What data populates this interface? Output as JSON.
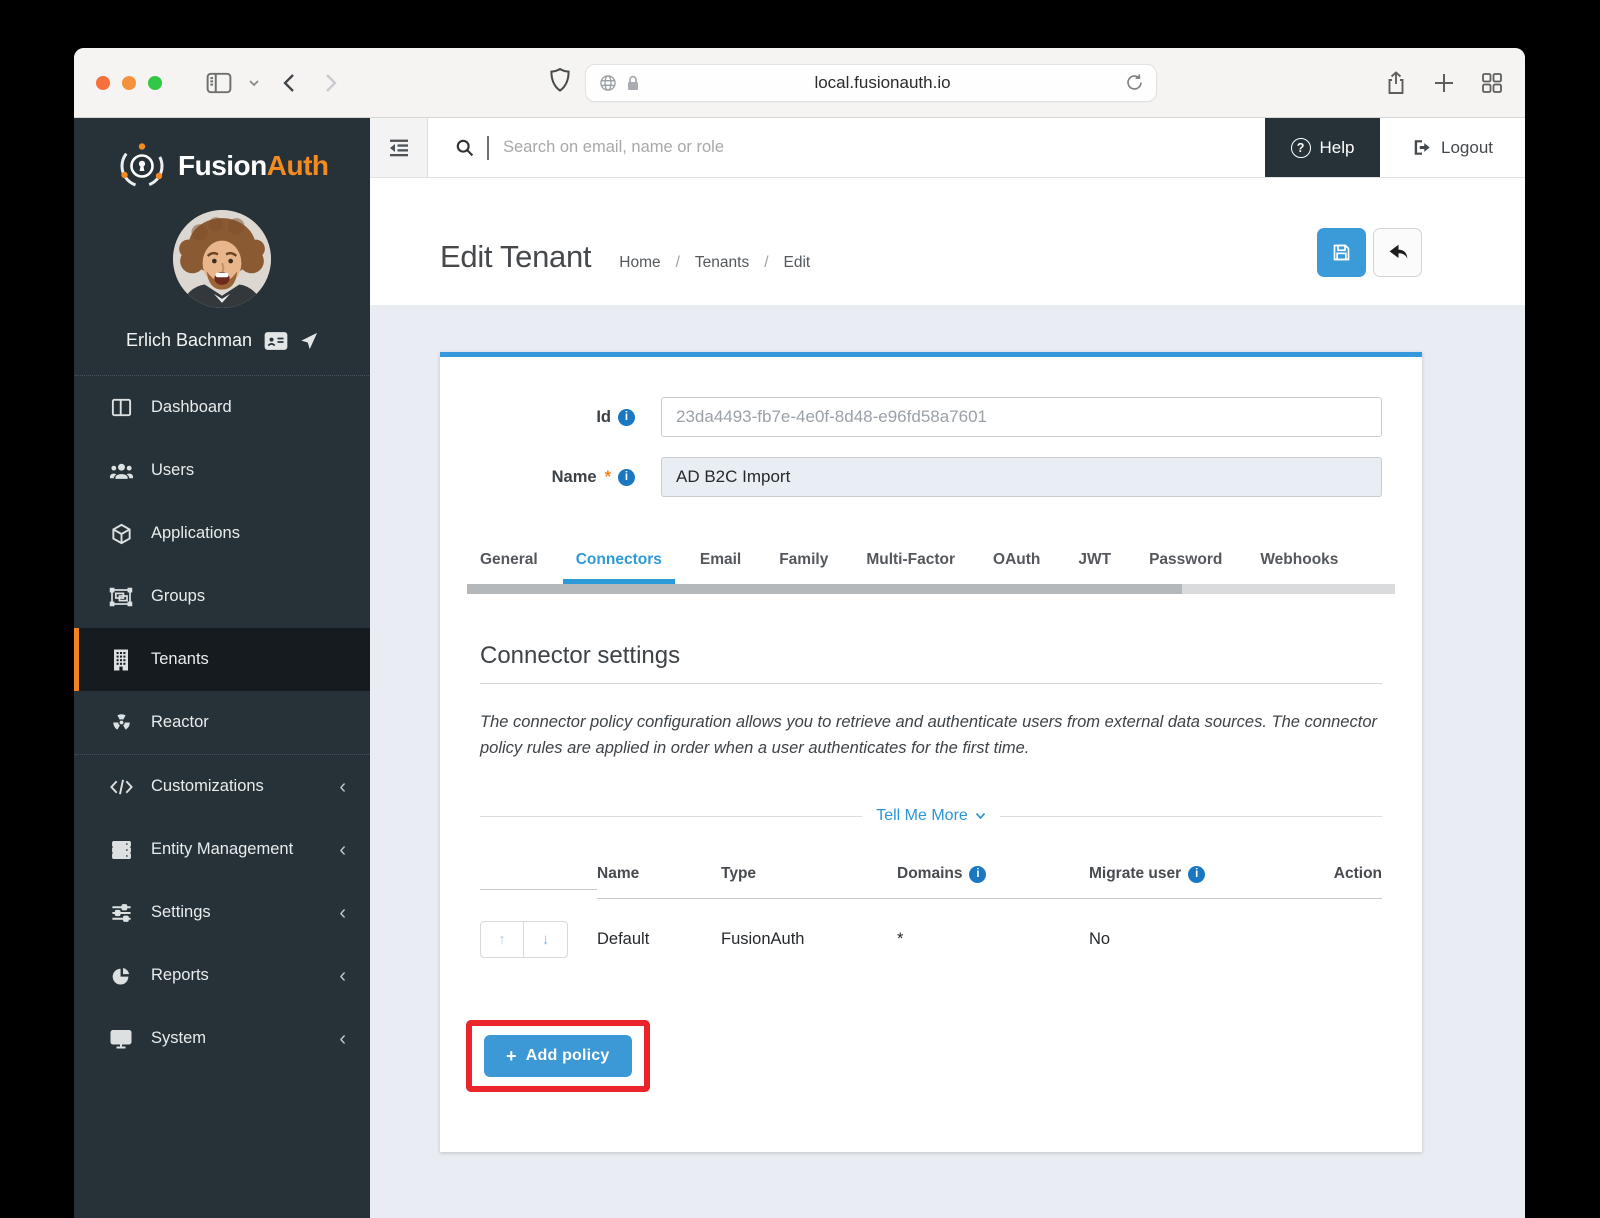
{
  "browser": {
    "url": "local.fusionauth.io"
  },
  "sidebar": {
    "brand": {
      "part1": "Fusion",
      "part2": "Auth"
    },
    "user": {
      "name": "Erlich Bachman"
    },
    "items": [
      {
        "label": "Dashboard",
        "icon": "dashboard-icon"
      },
      {
        "label": "Users",
        "icon": "users-icon"
      },
      {
        "label": "Applications",
        "icon": "applications-icon"
      },
      {
        "label": "Groups",
        "icon": "groups-icon"
      },
      {
        "label": "Tenants",
        "icon": "tenants-icon",
        "active": true
      },
      {
        "label": "Reactor",
        "icon": "reactor-icon"
      },
      {
        "label": "Customizations",
        "icon": "code-icon",
        "chevron": true
      },
      {
        "label": "Entity Management",
        "icon": "server-icon",
        "chevron": true
      },
      {
        "label": "Settings",
        "icon": "sliders-icon",
        "chevron": true
      },
      {
        "label": "Reports",
        "icon": "pie-chart-icon",
        "chevron": true
      },
      {
        "label": "System",
        "icon": "monitor-icon",
        "chevron": true
      }
    ]
  },
  "topbar": {
    "search_placeholder": "Search on email, name or role",
    "help_label": "Help",
    "logout_label": "Logout"
  },
  "page": {
    "title": "Edit Tenant",
    "breadcrumbs": [
      "Home",
      "Tenants",
      "Edit"
    ],
    "breadcrumb_separator": "/"
  },
  "form": {
    "id_label": "Id",
    "id_value": "23da4493-fb7e-4e0f-8d48-e96fd58a7601",
    "name_label": "Name",
    "name_value": "AD B2C Import"
  },
  "tabs": {
    "items": [
      "General",
      "Connectors",
      "Email",
      "Family",
      "Multi-Factor",
      "OAuth",
      "JWT",
      "Password",
      "Webhooks"
    ],
    "active": "Connectors"
  },
  "section": {
    "heading": "Connector settings",
    "description": "The connector policy configuration allows you to retrieve and authenticate users from external data sources. The connector policy rules are applied in order when a user authenticates for the first time.",
    "tell_me_more": "Tell Me More"
  },
  "table": {
    "headers": [
      "Name",
      "Type",
      "Domains",
      "Migrate user",
      "Action"
    ],
    "rows": [
      {
        "name": "Default",
        "type": "FusionAuth",
        "domains": "*",
        "migrate_user": "No"
      }
    ]
  },
  "actions": {
    "add_policy_label": "Add policy",
    "add_policy_plus": "+"
  },
  "glyphs": {
    "question_mark": "?",
    "required_mark": "*",
    "section_chevron": "‹",
    "up_arrow": "↑",
    "down_arrow": "↓",
    "info_i": "i"
  },
  "colors": {
    "sidebar_bg": "#263238",
    "accent_orange": "#f58320",
    "accent_blue": "#3b9ad8",
    "link_blue": "#2b96d8",
    "info_blue": "#1a78c2",
    "annotation_red": "#e9252b",
    "page_bg": "#e9edf3"
  }
}
